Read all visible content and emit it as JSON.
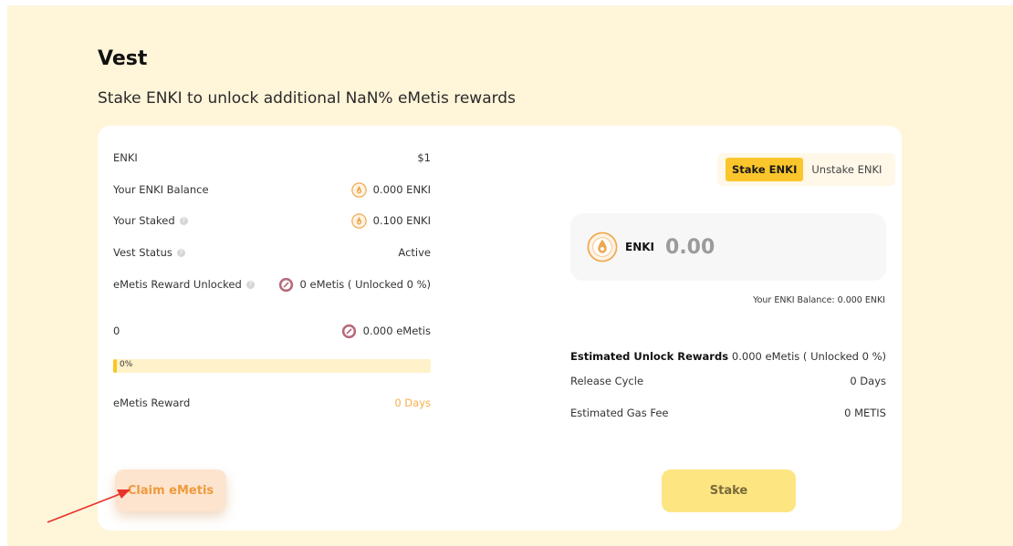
{
  "page": {
    "title": "Vest",
    "subtitle": "Stake ENKI to unlock additional NaN% eMetis rewards"
  },
  "left_panel": {
    "rows": [
      {
        "label": "ENKI",
        "value": "$1"
      },
      {
        "label": "Your ENKI Balance",
        "value": "0.000 ENKI",
        "icon": "enki-coin-icon"
      },
      {
        "label": "Your Staked",
        "value": "0.100 ENKI",
        "icon": "enki-coin-icon",
        "help": true
      },
      {
        "label": "Vest Status",
        "value": "Active",
        "help": true
      },
      {
        "label": "eMetis Reward Unlocked",
        "value": "0 eMetis ( Unlocked 0 %)",
        "icon": "emetis-coin-icon",
        "help": true
      },
      {
        "label": "0",
        "value": "0.000 eMetis",
        "icon": "emetis-coin-icon"
      }
    ],
    "progress": {
      "label": "0%",
      "fraction": 0.0
    },
    "reward": {
      "label": "eMetis Reward",
      "value": "0 Days"
    },
    "claim_button": "Claim eMetis"
  },
  "right_panel": {
    "tabs": [
      {
        "label": "Stake ENKI",
        "active": true
      },
      {
        "label": "Unstake ENKI",
        "active": false
      }
    ],
    "input": {
      "token": "ENKI",
      "amount": "0.00"
    },
    "balance_text": "Your ENKI Balance: 0.000 ENKI",
    "details": [
      {
        "label": "Estimated Unlock Rewards",
        "value": "0.000 eMetis ( Unlocked 0 %)",
        "bold": true
      },
      {
        "label": "Release Cycle",
        "value": "0 Days"
      },
      {
        "label": "Estimated Gas Fee",
        "value": "0 METIS"
      }
    ],
    "stake_button": "Stake"
  },
  "colors": {
    "background": "#fff5d9",
    "accent_yellow": "#fbc62b",
    "accent_orange": "#ee9b3c",
    "annotation_arrow": "#e8322a"
  }
}
